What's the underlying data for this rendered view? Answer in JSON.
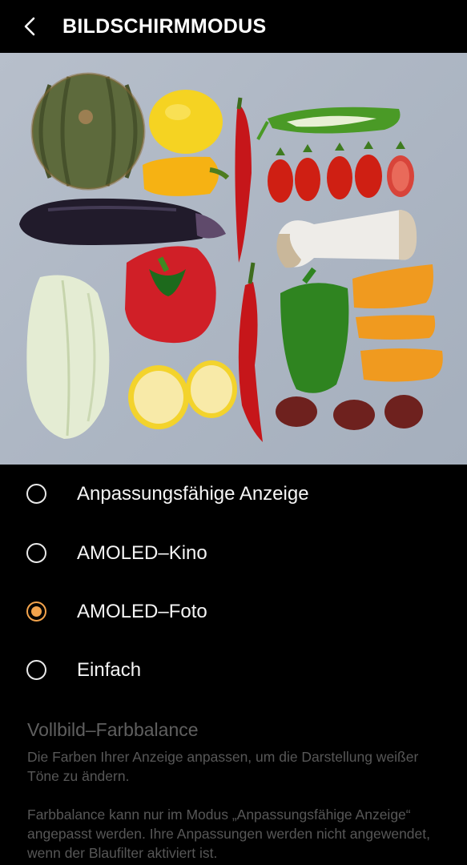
{
  "header": {
    "back_icon": "chevron-left-icon",
    "title": "BILDSCHIRMMODUS"
  },
  "preview": {
    "description_icon": "vegetables-photo"
  },
  "options": [
    {
      "label": "Anpassungsfähige Anzeige",
      "selected": false
    },
    {
      "label": "AMOLED–Kino",
      "selected": false
    },
    {
      "label": "AMOLED–Foto",
      "selected": true
    },
    {
      "label": "Einfach",
      "selected": false
    }
  ],
  "color_balance": {
    "title": "Vollbild–Farbbalance",
    "description": "Die Farben Ihrer Anzeige anpassen, um die Darstellung weißer Töne zu ändern.",
    "note": "Farbbalance kann nur im Modus „Anpassungsfähige Anzeige“ angepasst werden. Ihre Anpassungen werden nicht angewendet, wenn der Blaufilter aktiviert ist."
  },
  "colors": {
    "accent": "#f2a34c",
    "background": "#000000",
    "disabled_text": "#575757"
  }
}
